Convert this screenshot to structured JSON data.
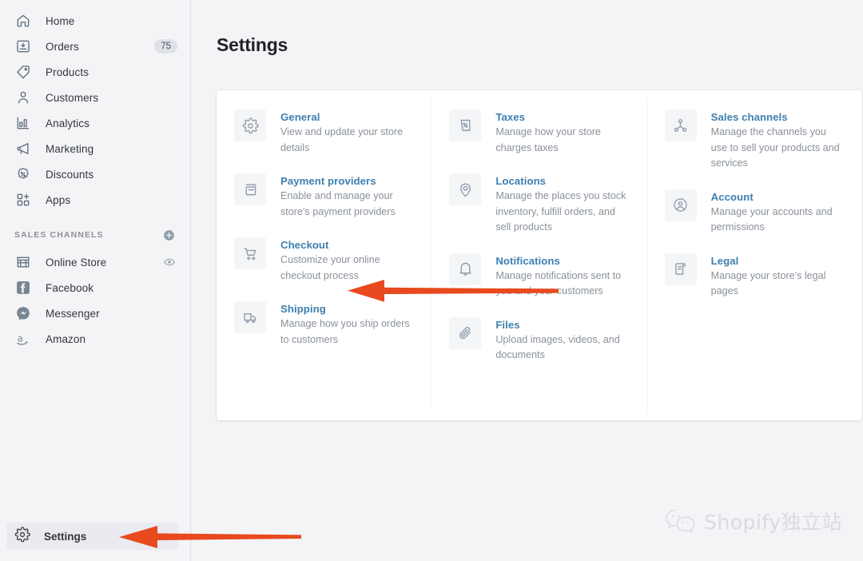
{
  "sidebar": {
    "nav": [
      {
        "label": "Home",
        "icon": "home-icon",
        "badge": null
      },
      {
        "label": "Orders",
        "icon": "orders-icon",
        "badge": "75"
      },
      {
        "label": "Products",
        "icon": "products-tag-icon",
        "badge": null
      },
      {
        "label": "Customers",
        "icon": "customers-icon",
        "badge": null
      },
      {
        "label": "Analytics",
        "icon": "analytics-bar-chart-icon",
        "badge": null
      },
      {
        "label": "Marketing",
        "icon": "marketing-megaphone-icon",
        "badge": null
      },
      {
        "label": "Discounts",
        "icon": "discounts-badge-percent-icon",
        "badge": null
      },
      {
        "label": "Apps",
        "icon": "apps-grid-icon",
        "badge": null
      }
    ],
    "sales_channels_heading": "SALES CHANNELS",
    "add_channel_icon": "plus-circle-icon",
    "channels": [
      {
        "label": "Online Store",
        "icon": "online-store-icon",
        "trailing_icon": "eye-icon"
      },
      {
        "label": "Facebook",
        "icon": "facebook-icon",
        "trailing_icon": null
      },
      {
        "label": "Messenger",
        "icon": "messenger-icon",
        "trailing_icon": null
      },
      {
        "label": "Amazon",
        "icon": "amazon-icon",
        "trailing_icon": null
      }
    ],
    "settings_item": {
      "label": "Settings",
      "icon": "gear-icon"
    }
  },
  "main": {
    "page_title": "Settings",
    "columns": [
      {
        "items": [
          {
            "icon": "gear-icon",
            "title": "General",
            "desc": "View and update your store details"
          },
          {
            "icon": "payment-card-icon",
            "title": "Payment providers",
            "desc": "Enable and manage your store's payment providers"
          },
          {
            "icon": "cart-icon",
            "title": "Checkout",
            "desc": "Customize your online checkout process"
          },
          {
            "icon": "truck-icon",
            "title": "Shipping",
            "desc": "Manage how you ship orders to customers"
          }
        ]
      },
      {
        "items": [
          {
            "icon": "tax-receipt-icon",
            "title": "Taxes",
            "desc": "Manage how your store charges taxes"
          },
          {
            "icon": "location-pin-icon",
            "title": "Locations",
            "desc": "Manage the places you stock inventory, fulfill orders, and sell products"
          },
          {
            "icon": "bell-icon",
            "title": "Notifications",
            "desc": "Manage notifications sent to you and your customers"
          },
          {
            "icon": "paperclip-icon",
            "title": "Files",
            "desc": "Upload images, videos, and documents"
          }
        ]
      },
      {
        "items": [
          {
            "icon": "sales-channels-node-icon",
            "title": "Sales channels",
            "desc": "Manage the channels you use to sell your products and services"
          },
          {
            "icon": "account-person-circle-icon",
            "title": "Account",
            "desc": "Manage your accounts and permissions"
          },
          {
            "icon": "legal-scroll-icon",
            "title": "Legal",
            "desc": "Manage your store's legal pages"
          }
        ]
      }
    ]
  },
  "annotations": {
    "arrow_color": "#e8491e",
    "checkout_arrow": "arrow-pointing-to-checkout",
    "settings_arrow": "arrow-pointing-to-settings"
  },
  "watermark": {
    "icon": "wechat-icon",
    "text": "Shopify独立站"
  },
  "colors": {
    "link": "#3e7fb0",
    "body_text": "#8a9199",
    "sidebar_bg": "#f4f4f7",
    "card_bg": "#ffffff",
    "accent_orange": "#e8491e"
  }
}
